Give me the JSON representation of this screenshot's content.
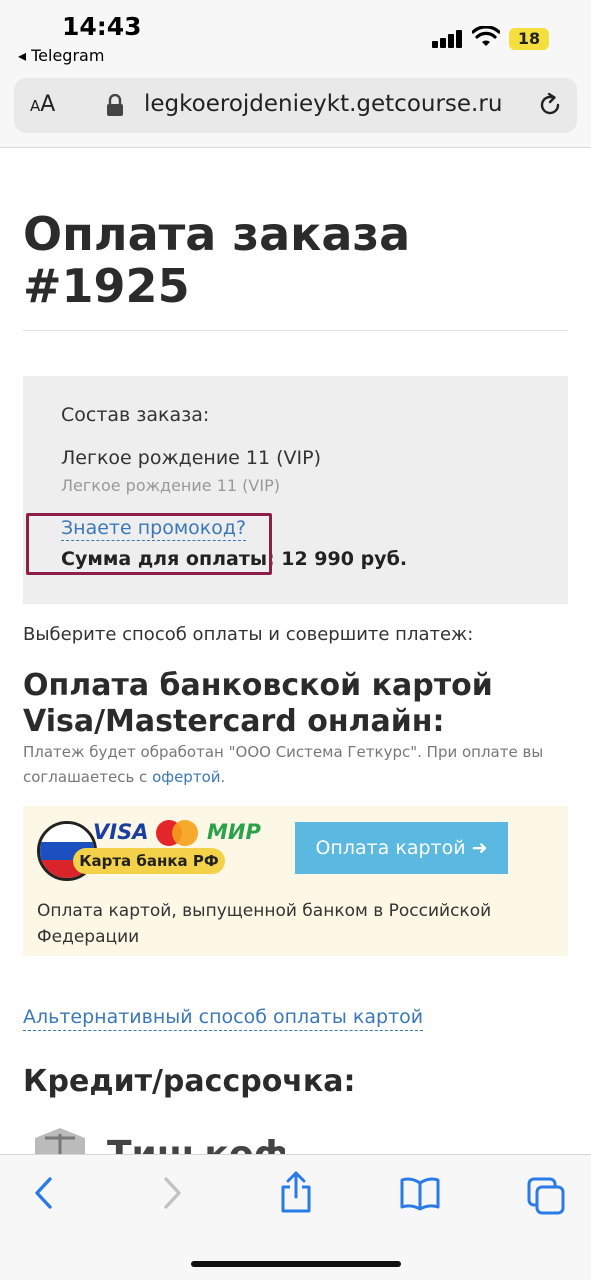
{
  "status_bar": {
    "time": "14:43",
    "back_app": "◂ Telegram",
    "battery": "18",
    "battery_color": "#f4df3c"
  },
  "address_bar": {
    "text_size": "AA",
    "url": "legkoerojdenieykt.getcourse.ru"
  },
  "page": {
    "title": "Оплата заказа #1925",
    "order": {
      "label": "Состав заказа:",
      "item": "Легкое рождение 11 (VIP)",
      "item_sub": "Легкое рождение 11 (VIP)",
      "promo_link": "Знаете промокод?",
      "sum_label": "Сумма для оплаты:",
      "sum_value": "12 990 руб."
    },
    "choose_text": "Выберите способ оплаты и совершите платеж:",
    "card_payment": {
      "title": "Оплата банковской картой Visa/Mastercard онлайн:",
      "note_prefix": "Платеж будет обработан \"ООО Система Геткурс\". При оплате вы соглашаетесь с ",
      "note_link": "офертой",
      "note_suffix": ".",
      "visa": "VISA",
      "mir": "МИР",
      "bank_pill": "Карта банка РФ",
      "button": "Оплата картой",
      "description": "Оплата картой, выпущенной банком в Российской Федерации"
    },
    "alt_link": "Альтернативный способ оплаты картой",
    "credit_title": "Кредит/рассрочка:",
    "tinkoff": "Тинькофф"
  },
  "colors": {
    "link": "#3a78b8",
    "pay_button": "#5bb8e0",
    "highlight_border": "#8c1f45",
    "card_box_bg": "#fdf8e6"
  },
  "toolbar_icons": [
    "back-icon",
    "forward-icon",
    "share-icon",
    "bookmarks-icon",
    "tabs-icon"
  ]
}
